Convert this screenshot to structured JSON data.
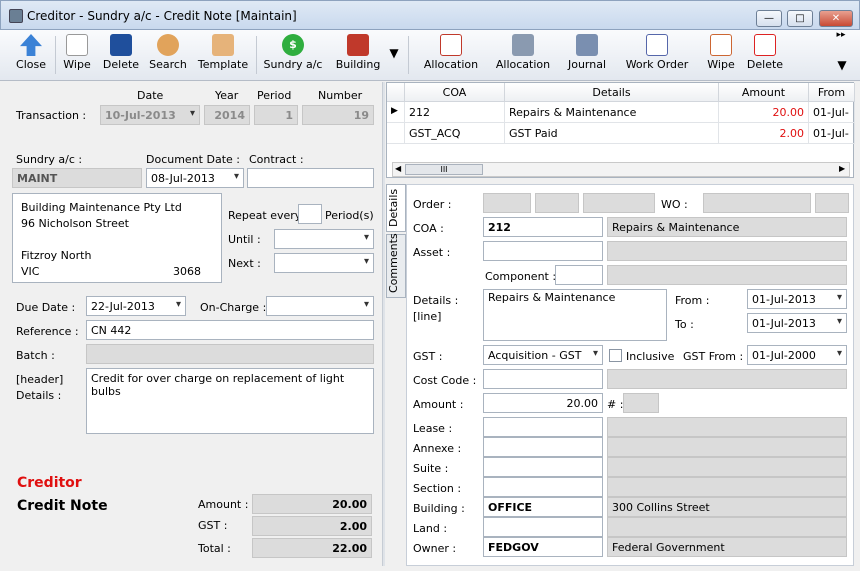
{
  "window": {
    "title": "Creditor - Sundry a/c - Credit Note [Maintain]"
  },
  "toolbar": {
    "close": "Close",
    "wipe": "Wipe",
    "delete": "Delete",
    "search": "Search",
    "template": "Template",
    "sundry": "Sundry a/c",
    "building": "Building",
    "allocation1": "Allocation",
    "allocation2": "Allocation",
    "journal": "Journal",
    "work_order": "Work Order",
    "wipe2": "Wipe",
    "delete2": "Delete"
  },
  "header": {
    "date_label": "Date",
    "year_label": "Year",
    "period_label": "Period",
    "number_label": "Number",
    "transaction_label": "Transaction :",
    "date": "10-Jul-2013",
    "year": "2014",
    "period": "1",
    "number": "19",
    "sundry_label": "Sundry a/c :",
    "sundry": "MAINT",
    "docdate_label": "Document Date :",
    "docdate": "08-Jul-2013",
    "contract_label": "Contract :",
    "contract": "",
    "address": {
      "line1": "Building Maintenance Pty Ltd",
      "line2": "96 Nicholson Street",
      "line3": "",
      "city": "Fitzroy North",
      "state": "VIC",
      "postcode": "3068"
    },
    "repeat_label": "Repeat every",
    "periods_label": "Period(s)",
    "until_label": "Until :",
    "next_label": "Next :",
    "duedate_label": "Due Date :",
    "duedate": "22-Jul-2013",
    "oncharge_label": "On-Charge :",
    "reference_label": "Reference :",
    "reference": "CN 442",
    "batch_label": "Batch :",
    "hdr_details_label1": "[header]",
    "hdr_details_label2": "Details :",
    "hdr_details": "Credit for over charge on replacement of light bulbs"
  },
  "summary": {
    "type1": "Creditor",
    "type2": "Credit Note",
    "amount_label": "Amount :",
    "amount": "20.00",
    "gst_label": "GST :",
    "gst": "2.00",
    "total_label": "Total :",
    "total": "22.00"
  },
  "grid": {
    "columns": [
      "COA",
      "Details",
      "Amount",
      "From"
    ],
    "rows": [
      {
        "coa": "212",
        "details": "Repairs & Maintenance",
        "amount": "20.00",
        "from": "01-Jul-"
      },
      {
        "coa": "GST_ACQ",
        "details": "GST Paid",
        "amount": "2.00",
        "from": "01-Jul-"
      }
    ]
  },
  "tabs": {
    "details": "Details",
    "comments": "Comments"
  },
  "detail": {
    "order_label": "Order :",
    "wo_label": "WO :",
    "coa_label": "COA :",
    "coa": "212",
    "coa_name": "Repairs & Maintenance",
    "asset_label": "Asset :",
    "component_label": "Component :",
    "details_label1": "Details :",
    "details_label2": "[line]",
    "details": "Repairs & Maintenance",
    "from_label": "From :",
    "from": "01-Jul-2013",
    "to_label": "To :",
    "to": "01-Jul-2013",
    "gst_label": "GST :",
    "gst": "Acquisition - GST",
    "inclusive_label": "Inclusive",
    "gstfrom_label": "GST From :",
    "gstfrom": "01-Jul-2000",
    "costcode_label": "Cost Code :",
    "amount_label": "Amount :",
    "amount": "20.00",
    "hash_label": "# :",
    "lease_label": "Lease :",
    "annexe_label": "Annexe :",
    "suite_label": "Suite :",
    "section_label": "Section :",
    "building_label": "Building :",
    "building": "OFFICE",
    "building_name": "300 Collins Street",
    "land_label": "Land :",
    "owner_label": "Owner :",
    "owner": "FEDGOV",
    "owner_name": "Federal Government"
  }
}
